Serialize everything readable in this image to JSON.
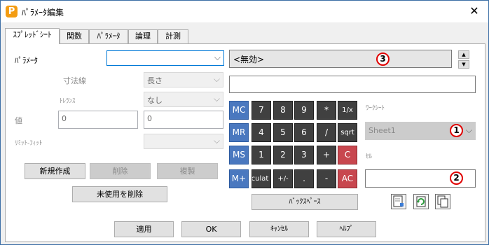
{
  "window": {
    "title": "ﾊﾟﾗﾒｰﾀ編集",
    "app_icon": "P"
  },
  "tabs": [
    {
      "label": "ｽﾌﾟﾚｯﾄﾞｼｰﾄ",
      "active": true
    },
    {
      "label": "関数",
      "active": false
    },
    {
      "label": "ﾊﾟﾗﾒｰﾀ",
      "active": false
    },
    {
      "label": "論理",
      "active": false
    },
    {
      "label": "計測",
      "active": false
    }
  ],
  "form": {
    "parameter_label": "ﾊﾟﾗﾒｰﾀ",
    "parameter_value": "",
    "dimension_label": "寸法線",
    "dimension_value": "長さ",
    "tolerance_label": "ﾄﾚﾗﾝｽ",
    "tolerance_value": "なし",
    "value_label": "値",
    "value1": "0",
    "value2": "0",
    "limit_fit_label": "ﾘﾐｯﾄ-ﾌｨｯﾄ",
    "limit_fit_value": ""
  },
  "buttons": {
    "new": "新規作成",
    "delete": "削除",
    "duplicate": "複製",
    "delete_unused": "未使用を削除",
    "backspace": "ﾊﾞｯｸｽﾍﾟｰｽ",
    "apply": "適用",
    "ok": "OK",
    "cancel": "ｷｬﾝｾﾙ",
    "help": "ﾍﾙﾌﾟ"
  },
  "display": {
    "text": "<無効>",
    "input": ""
  },
  "callouts": {
    "c1": "1",
    "c2": "2",
    "c3": "3"
  },
  "keypad": [
    [
      "MC",
      "7",
      "8",
      "9",
      "*",
      "1/x"
    ],
    [
      "MR",
      "4",
      "5",
      "6",
      "/",
      "sqrt"
    ],
    [
      "MS",
      "1",
      "2",
      "3",
      "+",
      "C"
    ],
    [
      "M+",
      "Calculat",
      "+/-",
      ".",
      "-",
      "AC"
    ]
  ],
  "worksheet": {
    "label": "ﾜｰｸｼｰﾄ",
    "value": "Sheet1"
  },
  "cell": {
    "label": "ｾﾙ",
    "value": ""
  },
  "icons": {
    "close": "close-icon",
    "doc_edit": "document-edit-icon",
    "sheet_refresh": "sheet-refresh-icon",
    "copy": "copy-icon"
  },
  "colors": {
    "memory_key": "#4a78bf",
    "clear_key": "#c8474f",
    "digit_key": "#404040",
    "callout": "#e00000"
  }
}
